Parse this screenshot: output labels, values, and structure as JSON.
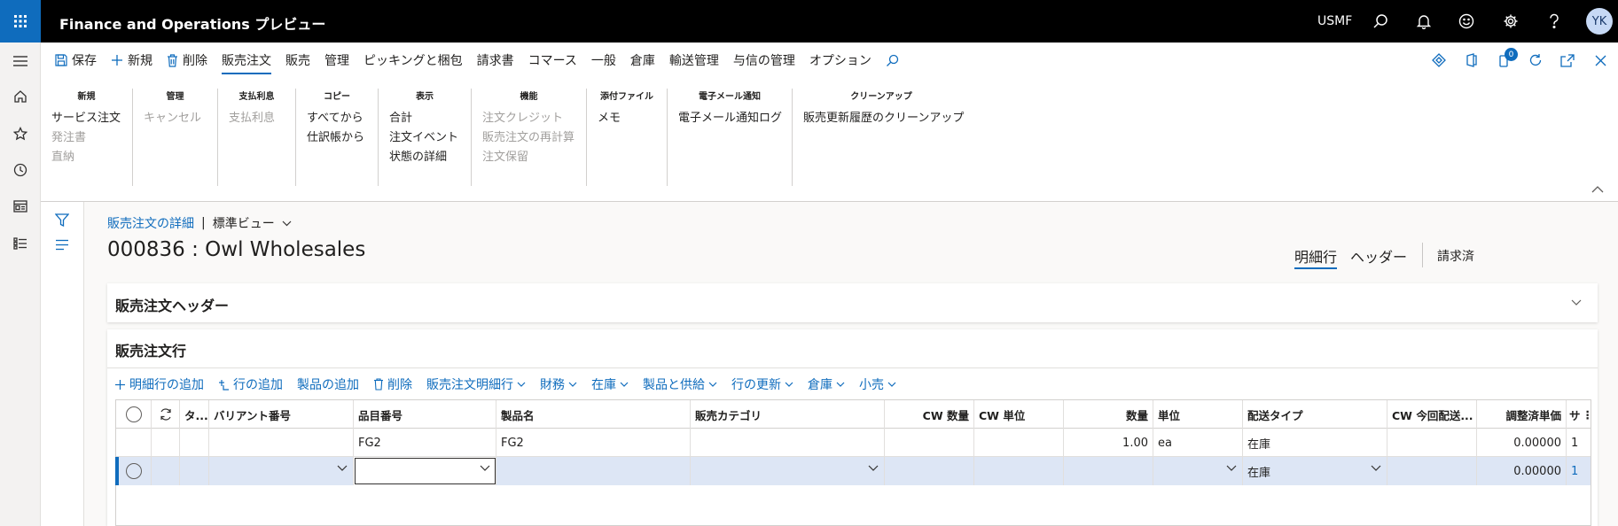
{
  "app": {
    "title": "Finance and Operations プレビュー",
    "company": "USMF",
    "user_initials": "YK"
  },
  "actionbar": {
    "save": "保存",
    "new": "新規",
    "delete": "削除",
    "tabs": [
      "販売注文",
      "販売",
      "管理",
      "ピッキングと梱包",
      "請求書",
      "コマース",
      "一般",
      "倉庫",
      "輸送管理",
      "与信の管理",
      "オプション"
    ],
    "notification_count": "0"
  },
  "ribbon": {
    "groups": [
      {
        "title": "新規",
        "items": [
          {
            "label": "サービス注文",
            "disabled": false
          },
          {
            "label": "発注書",
            "disabled": true
          },
          {
            "label": "直納",
            "disabled": true
          }
        ]
      },
      {
        "title": "管理",
        "items": [
          {
            "label": "キャンセル",
            "disabled": true
          }
        ]
      },
      {
        "title": "支払利息",
        "items": [
          {
            "label": "支払利息",
            "disabled": true
          }
        ]
      },
      {
        "title": "コピー",
        "items": [
          {
            "label": "すべてから",
            "disabled": false
          },
          {
            "label": "仕訳帳から",
            "disabled": false
          }
        ]
      },
      {
        "title": "表示",
        "items": [
          {
            "label": "合計",
            "disabled": false
          },
          {
            "label": "注文イベント",
            "disabled": false
          },
          {
            "label": "状態の詳細",
            "disabled": false
          }
        ]
      },
      {
        "title": "機能",
        "items": [
          {
            "label": "注文クレジット",
            "disabled": true
          },
          {
            "label": "販売注文の再計算",
            "disabled": true
          },
          {
            "label": "注文保留",
            "disabled": true
          }
        ]
      },
      {
        "title": "添付ファイル",
        "items": [
          {
            "label": "メモ",
            "disabled": false
          }
        ]
      },
      {
        "title": "電子メール通知",
        "items": [
          {
            "label": "電子メール通知ログ",
            "disabled": false
          }
        ]
      },
      {
        "title": "クリーンアップ",
        "items": [
          {
            "label": "販売更新履歴のクリーンアップ",
            "disabled": false
          }
        ]
      }
    ]
  },
  "page": {
    "breadcrumb_link": "販売注文の詳細",
    "breadcrumb_sep": "|",
    "view": "標準ビュー",
    "title": "000836 : Owl Wholesales",
    "tabs": [
      "明細行",
      "ヘッダー",
      "請求済"
    ]
  },
  "header_section": {
    "title": "販売注文ヘッダー"
  },
  "lines_section": {
    "title": "販売注文行",
    "toolbar": [
      {
        "label": "明細行の追加",
        "icon": "plus-icon",
        "dropdown": false
      },
      {
        "label": "行の追加",
        "icon": "insert-row-icon",
        "dropdown": false
      },
      {
        "label": "製品の追加",
        "icon": "",
        "dropdown": false
      },
      {
        "label": "削除",
        "icon": "delete-icon",
        "dropdown": false
      },
      {
        "label": "販売注文明細行",
        "icon": "",
        "dropdown": true
      },
      {
        "label": "財務",
        "icon": "",
        "dropdown": true
      },
      {
        "label": "在庫",
        "icon": "",
        "dropdown": true
      },
      {
        "label": "製品と供給",
        "icon": "",
        "dropdown": true
      },
      {
        "label": "行の更新",
        "icon": "",
        "dropdown": true
      },
      {
        "label": "倉庫",
        "icon": "",
        "dropdown": true
      },
      {
        "label": "小売",
        "icon": "",
        "dropdown": true
      }
    ],
    "columns": [
      "タ...",
      "バリアント番号",
      "品目番号",
      "製品名",
      "販売カテゴリ",
      "CW 数量",
      "CW 単位",
      "数量",
      "単位",
      "配送タイプ",
      "CW 今回配送...",
      "調整済単価",
      "サ"
    ],
    "rows": [
      {
        "variant": "",
        "item": "FG2",
        "product": "FG2",
        "category": "",
        "cw_qty": "",
        "cw_unit": "",
        "qty": "1.00",
        "unit": "ea",
        "delivery": "在庫",
        "cw_deliver": "",
        "price": "0.00000",
        "site": "1"
      },
      {
        "variant": "",
        "item": "",
        "product": "",
        "category": "",
        "cw_qty": "",
        "cw_unit": "",
        "qty": "",
        "unit": "",
        "delivery": "在庫",
        "cw_deliver": "",
        "price": "0.00000",
        "site": "1"
      }
    ]
  }
}
